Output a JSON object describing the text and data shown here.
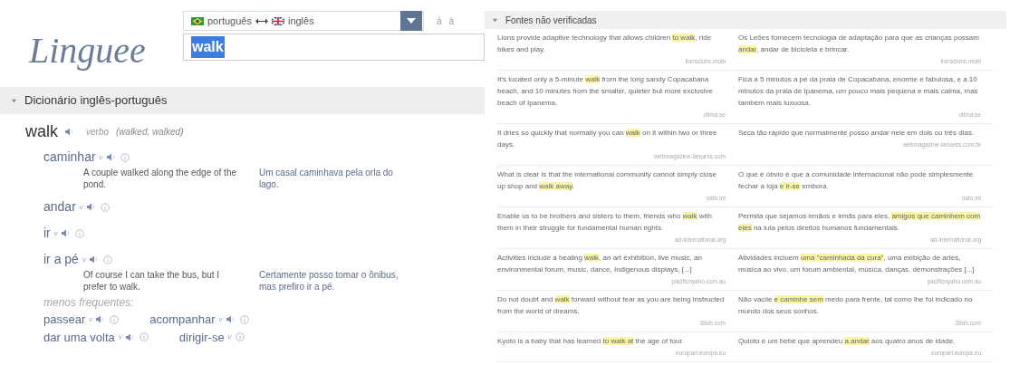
{
  "logo": "Linguee",
  "language_selector": {
    "source": "português",
    "target": "inglês"
  },
  "accent_buttons": [
    "á",
    "à"
  ],
  "search": {
    "value": "walk",
    "selected": true
  },
  "dictionary": {
    "title": "Dicionário inglês-português",
    "expanded": true,
    "headword": "walk",
    "pos": "verbo",
    "forms": "(walked, walked)",
    "translations": [
      {
        "word": "caminhar",
        "pos": "v",
        "audio": true,
        "examples": [
          {
            "en": "A couple walked along the edge of the pond.",
            "pt": "Um casal caminhava pela orla do lago."
          }
        ]
      },
      {
        "word": "andar",
        "pos": "v",
        "audio": true
      },
      {
        "word": "ir",
        "pos": "v",
        "audio": true
      },
      {
        "word": "ir a pé",
        "pos": "v",
        "audio": true,
        "examples": [
          {
            "en": "Of course I can take the bus, but I prefer to walk.",
            "pt": "Certamente posso tomar o ônibus, mas prefiro ir a pé."
          }
        ]
      }
    ],
    "less_frequent_label": "menos frequentes:",
    "less_frequent": [
      [
        {
          "word": "passear",
          "pos": "v",
          "audio": true
        },
        {
          "word": "acompanhar",
          "pos": "v",
          "audio": true
        }
      ],
      [
        {
          "word": "dar uma volta",
          "pos": "v",
          "audio": true
        },
        {
          "word": "dirigir-se",
          "pos": "v",
          "audio": false
        }
      ]
    ]
  },
  "sources": {
    "title": "Fontes não verificadas",
    "expanded": true,
    "rows": [
      {
        "en": "Lions provide adaptive technology that allows children **to walk**, ride bikes and play.",
        "en_source": "lionsclubs.mobi",
        "pt": "Os Leões fornecem tecnologia de adaptação para que as crianças possam **andar**, andar de bicicleta e brincar.",
        "pt_source": "lionsclubs.mobi"
      },
      {
        "en": "It's located only a 5-minute **walk** from the long sandy Copacabana beach, and 10 minutes from the smaller, quieter but more exclusive beach of Ipanema.",
        "en_source": "otima.se",
        "pt": "Fica a 5 minutos a pé da praia de Copacabana, enorme e fabulosa, e a 10 minutos da praia de Ipanema, um pouco mais pequena e mais calma, mas também mais luxuosa.",
        "pt_source": "otima.se"
      },
      {
        "en": "It dries so quickly that normally you can **walk** on it within two or three days.",
        "en_source": "webmagazine-lanuess.com",
        "pt": "Seca tão rápido que normalmente posso andar nele em dois ou três dias.",
        "pt_source": "webmagazine-lanuess.com.br"
      },
      {
        "en": "What is clear is that the international community cannot simply close up shop and **walk away**.",
        "en_source": "nato.int",
        "pt": "O que é óbvio é que a comunidade internacional não pode simplesmente fechar a loja **e ir-se** embora.",
        "pt_source": "nato.int"
      },
      {
        "en": "Enable us to be brothers and sisters to them, friends who **walk** with them in their struggle for fundamental human rights.",
        "en_source": "ad-international.org",
        "pt": "Permita que sejamos irmãos e irmãs para eles, **amigos que caminhem com eles** na luta pelos direitos humanos fundamentais.",
        "pt_source": "ad-international.org"
      },
      {
        "en": "Activities include a healing **walk**, an art exhibition, live music, an environmental forum, music, dance, Indigenous displays, [...]",
        "en_source": "pacificnyaho.com.au",
        "pt": "Atividades incluem **uma \"caminhada da cura\"**, uma exibição de artes, música ao vivo, um fórum ambiental, música, danças, demonstrações [...]",
        "pt_source": "pacificnyaho.com.au"
      },
      {
        "en": "Do not doubt and **walk** forward without fear as you are being instructed from the world of dreams.",
        "en_source": "39uh.com",
        "pt": "Não vacile **e caminhe sem** medo para frente, tal como lhe foi indicado no mundo dos seus sonhos.",
        "pt_source": "39uh.com"
      },
      {
        "en": "Kyoto is a baby that has learned **to walk at** the age of four.",
        "en_source": "europarl.europa.eu",
        "pt": "Quioto é um bebé que aprendeu **a andar** aos quatro anos de idade.",
        "pt_source": "europarl.europa.eu"
      }
    ]
  }
}
